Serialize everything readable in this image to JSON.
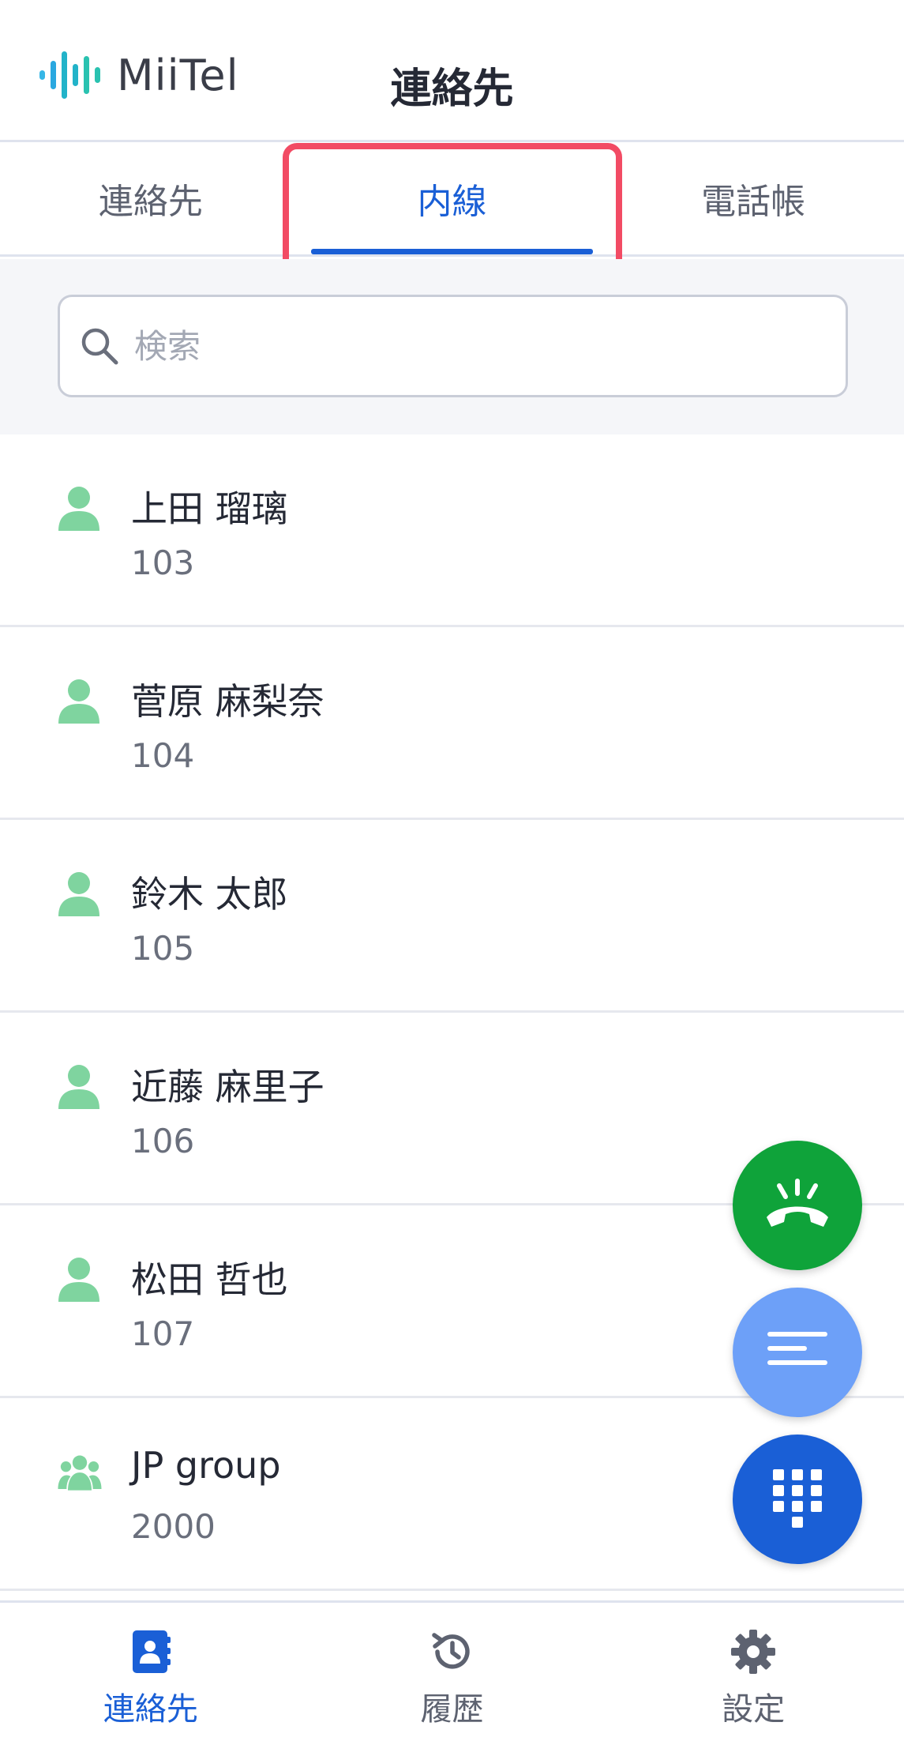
{
  "header": {
    "logo_text": "MiiTel",
    "title": "連絡先"
  },
  "tabs": [
    {
      "label": "連絡先",
      "active": false
    },
    {
      "label": "内線",
      "active": true
    },
    {
      "label": "電話帳",
      "active": false
    }
  ],
  "search": {
    "placeholder": "検索",
    "value": ""
  },
  "contacts": [
    {
      "name": "上田 瑠璃",
      "ext": "103",
      "type": "person"
    },
    {
      "name": "菅原 麻梨奈",
      "ext": "104",
      "type": "person"
    },
    {
      "name": "鈴木 太郎",
      "ext": "105",
      "type": "person"
    },
    {
      "name": "近藤 麻里子",
      "ext": "106",
      "type": "person"
    },
    {
      "name": "松田 哲也",
      "ext": "107",
      "type": "person"
    },
    {
      "name": "JP group",
      "ext": "2000",
      "type": "group"
    }
  ],
  "fabs": {
    "call_icon": "ringing-phone-icon",
    "notes_icon": "text-lines-icon",
    "dial_icon": "dialpad-icon"
  },
  "bottom_nav": [
    {
      "label": "連絡先",
      "icon": "contacts-book-icon",
      "active": true
    },
    {
      "label": "履歴",
      "icon": "history-icon",
      "active": false
    },
    {
      "label": "設定",
      "icon": "gear-icon",
      "active": false
    }
  ],
  "colors": {
    "accent": "#1a5fd6",
    "highlight": "#f24b64",
    "avatar": "#7fd49f",
    "call_green": "#0fa33a",
    "notes_blue": "#6da0f8"
  }
}
